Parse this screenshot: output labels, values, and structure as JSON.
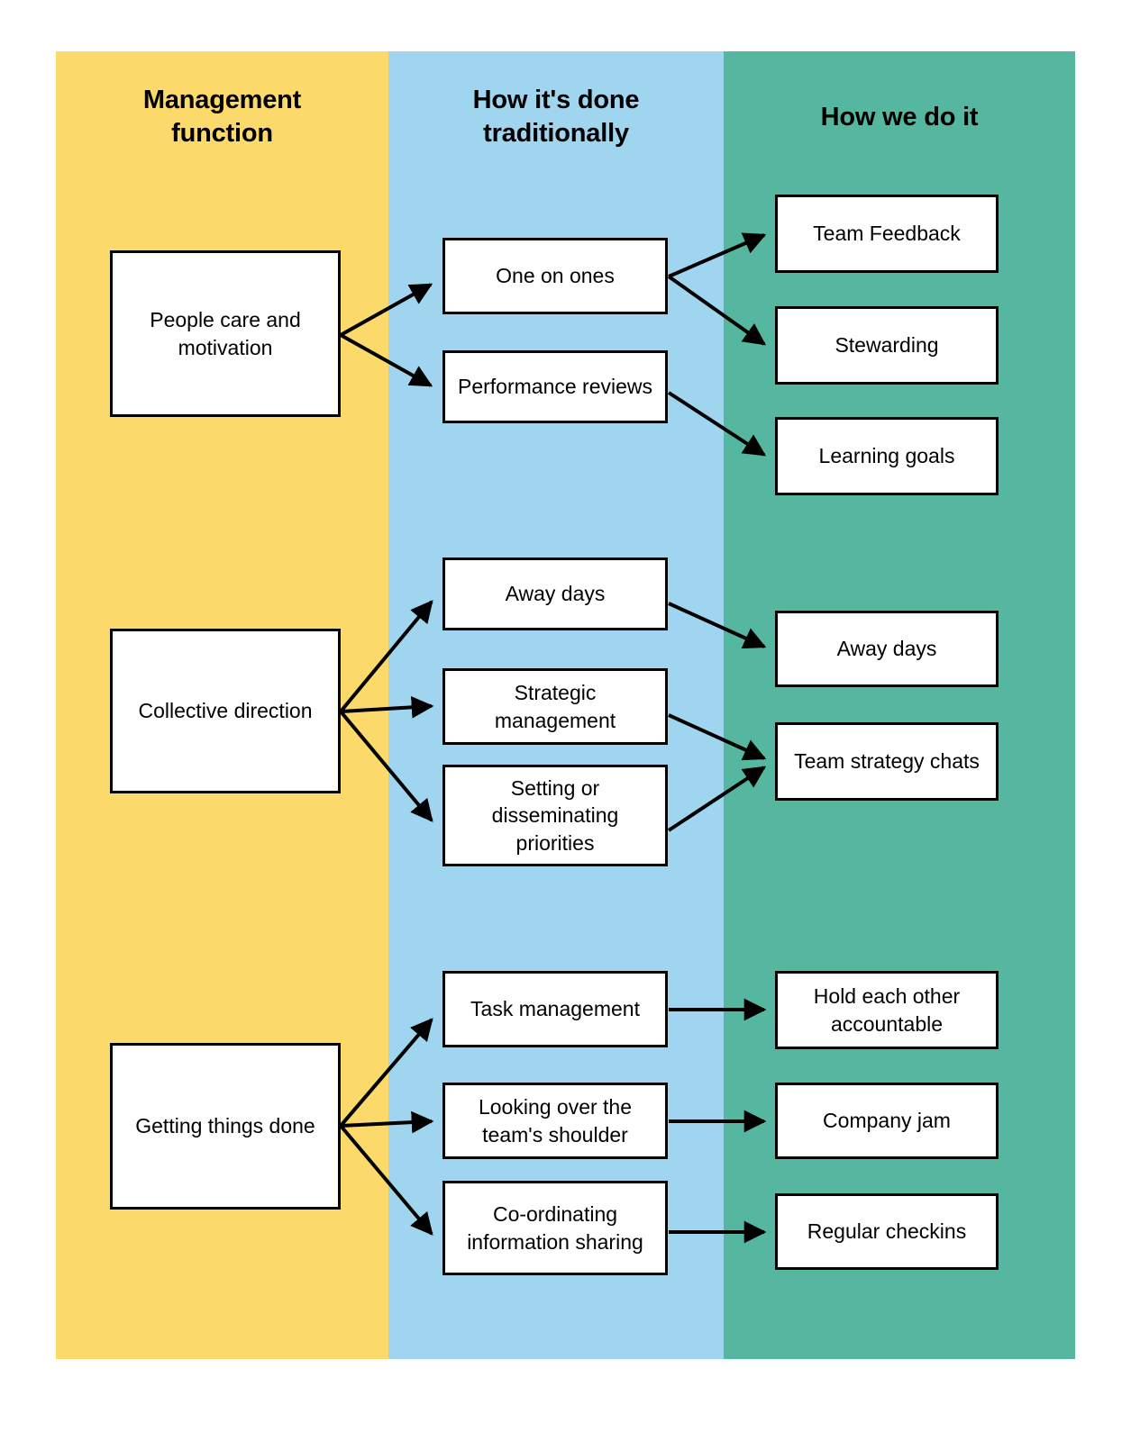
{
  "columns": [
    {
      "key": "management",
      "header": "Management\nfunction",
      "color": "#FCD96B"
    },
    {
      "key": "traditional",
      "header": "How it's done\ntraditionally",
      "color": "#A0D5F0"
    },
    {
      "key": "ours",
      "header": "How we do it",
      "color": "#55B79F"
    }
  ],
  "headers": {
    "management": "Management function",
    "management_line1": "Management",
    "management_line2": "function",
    "traditional": "How it's done traditionally",
    "traditional_line1": "How it's done",
    "traditional_line2": "traditionally",
    "ours": "How we do it"
  },
  "nodes": {
    "people_care": "People care and motivation",
    "collective_direction": "Collective direction",
    "getting_things_done": "Getting things done",
    "one_on_ones": "One on ones",
    "performance_reviews": "Performance reviews",
    "away_days_trad": "Away days",
    "strategic_management": "Strategic management",
    "setting_priorities": "Setting or disseminating priorities",
    "task_management": "Task management",
    "looking_over_shoulder": "Looking over the team's shoulder",
    "coordinating_info": "Co-ordinating information sharing",
    "team_feedback": "Team Feedback",
    "stewarding": "Stewarding",
    "learning_goals": "Learning goals",
    "away_days_ours": "Away days",
    "team_strategy_chats": "Team strategy chats",
    "hold_accountable": "Hold each other accountable",
    "company_jam": "Company jam",
    "regular_checkins": "Regular checkins"
  },
  "edges": [
    {
      "from": "people_care",
      "to": "one_on_ones"
    },
    {
      "from": "people_care",
      "to": "performance_reviews"
    },
    {
      "from": "one_on_ones",
      "to": "team_feedback"
    },
    {
      "from": "one_on_ones",
      "to": "stewarding"
    },
    {
      "from": "performance_reviews",
      "to": "learning_goals"
    },
    {
      "from": "collective_direction",
      "to": "away_days_trad"
    },
    {
      "from": "collective_direction",
      "to": "strategic_management"
    },
    {
      "from": "collective_direction",
      "to": "setting_priorities"
    },
    {
      "from": "away_days_trad",
      "to": "away_days_ours"
    },
    {
      "from": "strategic_management",
      "to": "team_strategy_chats"
    },
    {
      "from": "setting_priorities",
      "to": "team_strategy_chats"
    },
    {
      "from": "getting_things_done",
      "to": "task_management"
    },
    {
      "from": "getting_things_done",
      "to": "looking_over_shoulder"
    },
    {
      "from": "getting_things_done",
      "to": "coordinating_info"
    },
    {
      "from": "task_management",
      "to": "hold_accountable"
    },
    {
      "from": "looking_over_shoulder",
      "to": "company_jam"
    },
    {
      "from": "coordinating_info",
      "to": "regular_checkins"
    }
  ],
  "style": {
    "node_fill": "#FFFFFF",
    "node_border": "#000000",
    "edge_color": "#000000",
    "text_color": "#000000"
  }
}
